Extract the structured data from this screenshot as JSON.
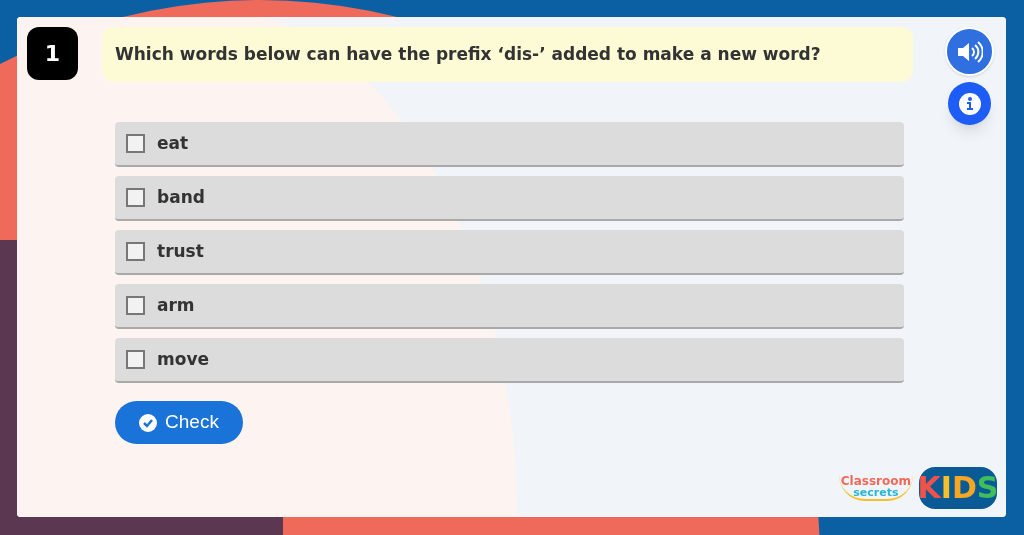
{
  "question": {
    "number": "1",
    "text": "Which words below can have the prefix ‘dis-’ added to make a new word?"
  },
  "options": [
    {
      "label": "eat",
      "checked": false
    },
    {
      "label": "band",
      "checked": false
    },
    {
      "label": "trust",
      "checked": false
    },
    {
      "label": "arm",
      "checked": false
    },
    {
      "label": "move",
      "checked": false
    }
  ],
  "check_button": "Check",
  "logo": {
    "brand_top": "Classroom",
    "brand_bottom": "secrets",
    "letters": [
      {
        "text": "K",
        "color": "#f0524a"
      },
      {
        "text": "I",
        "color": "#f5c028"
      },
      {
        "text": "D",
        "color": "#f5a623"
      },
      {
        "text": "S",
        "color": "#3fbf5a"
      }
    ]
  }
}
